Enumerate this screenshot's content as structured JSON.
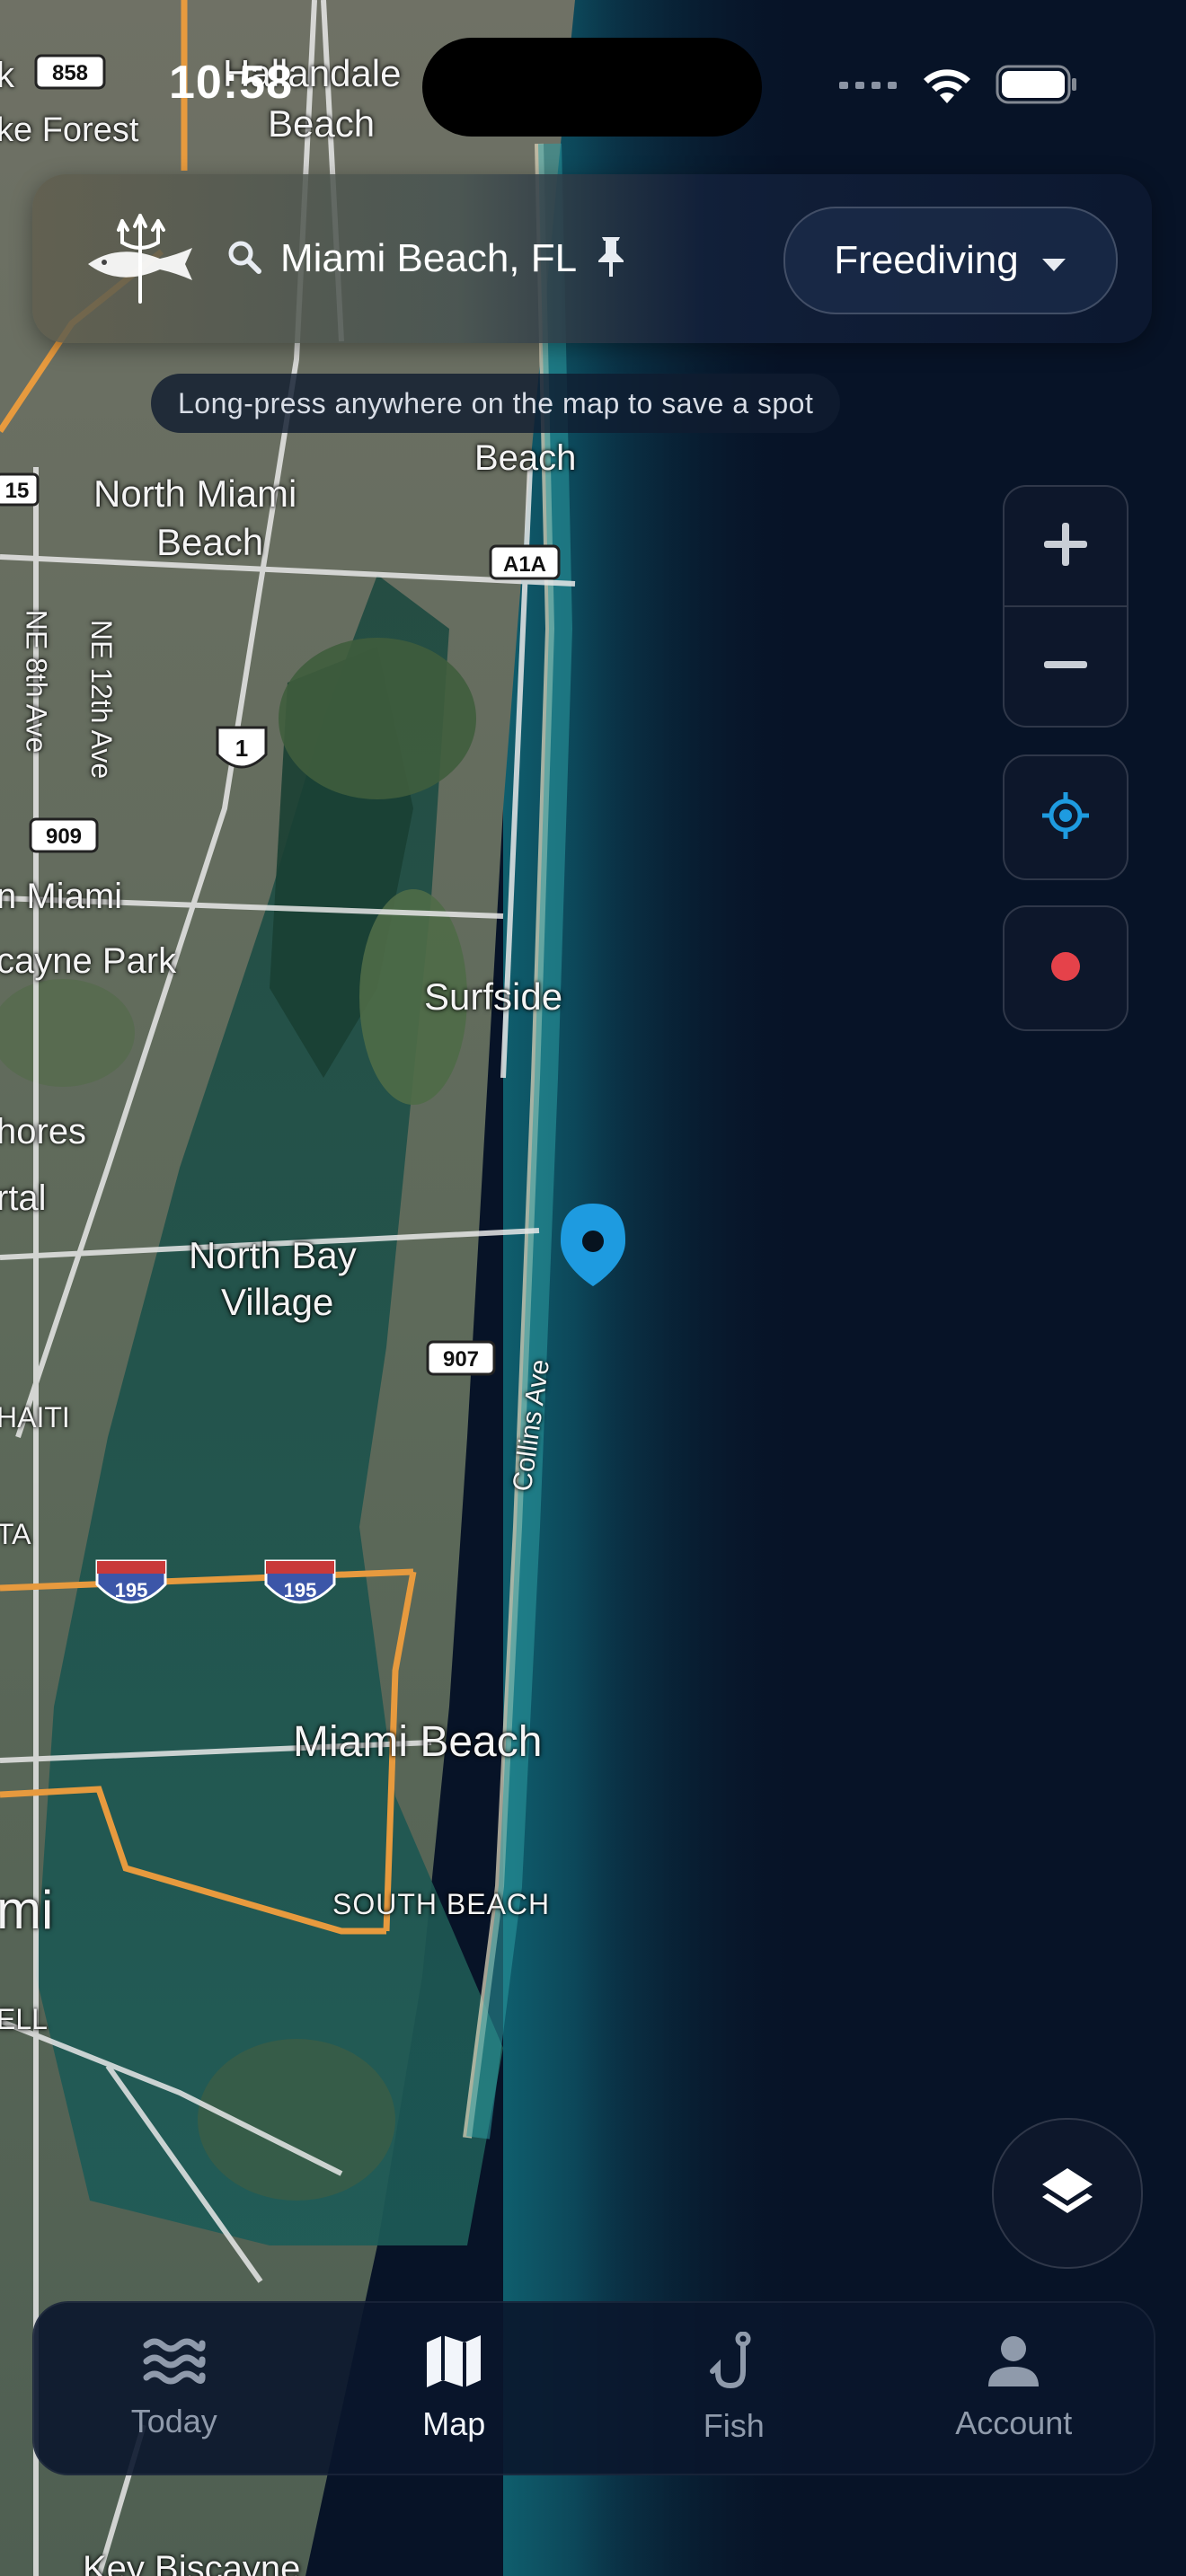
{
  "status_bar": {
    "time": "10:58"
  },
  "search_bar": {
    "location": "Miami Beach, FL",
    "sport_selected": "Freediving",
    "logo_icon": "trident-fish-logo-icon"
  },
  "hint": "Long-press anywhere on the map to save a spot",
  "map": {
    "labels": {
      "hallandale": "Hallandale",
      "hallandale_beach": "Beach",
      "lake_forest": "ke Forest",
      "k858": "k",
      "beach_top": "Beach",
      "north_miami_beach_1": "North Miami",
      "north_miami_beach_2": "Beach",
      "ne8": "NE 8th Ave",
      "ne12": "NE 12th Ave",
      "n_miami": "n Miami",
      "biscayne_park": "cayne Park",
      "surfside": "Surfside",
      "shores": "hores",
      "rtal": "rtal",
      "north_bay_1": "North Bay",
      "north_bay_2": "Village",
      "collins": "Collins Ave",
      "haiti": "HAITI",
      "ta": "TA",
      "miami_beach": "Miami Beach",
      "south_beach": "SOUTH BEACH",
      "mi": "mi",
      "ell": "ELL",
      "key_biscayne": "Key Biscayne"
    },
    "shields": {
      "r858": "858",
      "r15": "15",
      "a1a": "A1A",
      "us1": "1",
      "r909": "909",
      "r907": "907",
      "i195a": "195",
      "i195b": "195"
    }
  },
  "controls": {
    "zoom_in_icon": "plus-icon",
    "zoom_out_icon": "minus-icon",
    "locate_icon": "crosshair-icon",
    "record_icon": "record-dot-icon",
    "layers_icon": "layers-icon"
  },
  "nav": {
    "tabs": [
      {
        "label": "Today",
        "icon": "waves-icon",
        "active": false
      },
      {
        "label": "Map",
        "icon": "map-icon",
        "active": true
      },
      {
        "label": "Fish",
        "icon": "fish-hook-icon",
        "active": false
      },
      {
        "label": "Account",
        "icon": "person-icon",
        "active": false
      }
    ]
  },
  "colors": {
    "ocean": "#071327",
    "accent_blue": "#1e9be0",
    "record_red": "#e5424a",
    "highway_orange": "#e79a3e"
  }
}
